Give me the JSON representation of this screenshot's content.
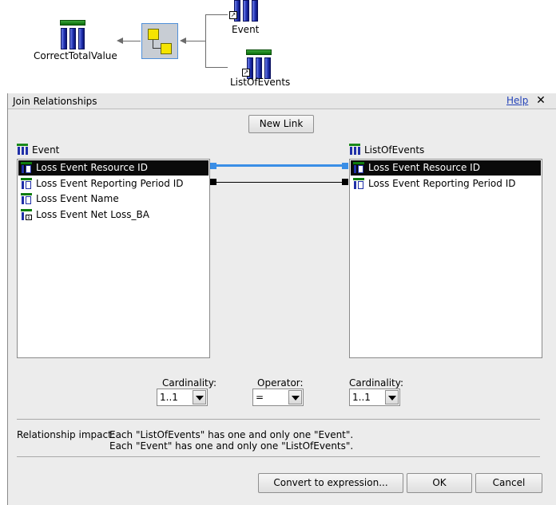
{
  "diagram": {
    "nodes": {
      "correct_total": "CorrectTotalValue",
      "event": "Event",
      "list_of_events": "ListOfEvents"
    }
  },
  "dialog": {
    "title": "Join Relationships",
    "help": "Help",
    "close": "✕",
    "new_link": "New Link",
    "left": {
      "header": "Event",
      "rows": [
        {
          "label": "Loss Event Resource ID",
          "selected": true,
          "icon": "column-icon"
        },
        {
          "label": "Loss Event Reporting Period ID",
          "selected": false,
          "icon": "column-icon"
        },
        {
          "label": "Loss Event Name",
          "selected": false,
          "icon": "column-icon"
        },
        {
          "label": "Loss Event Net Loss_BA",
          "selected": false,
          "icon": "calculated-column-icon"
        }
      ]
    },
    "right": {
      "header": "ListOfEvents",
      "rows": [
        {
          "label": "Loss Event Resource ID",
          "selected": true,
          "icon": "column-icon"
        },
        {
          "label": "Loss Event Reporting Period ID",
          "selected": false,
          "icon": "column-icon"
        }
      ]
    },
    "link_colors": {
      "selected": "#3a8ee6",
      "normal": "#000000"
    },
    "cardinality_left": {
      "label": "Cardinality:",
      "value": "1..1"
    },
    "operator": {
      "label": "Operator:",
      "value": "="
    },
    "cardinality_right": {
      "label": "Cardinality:",
      "value": "1..1"
    },
    "impact": {
      "label": "Relationship impact:",
      "line1": "Each \"ListOfEvents\" has one and only one \"Event\".",
      "line2": "Each \"Event\" has one and only one \"ListOfEvents\"."
    },
    "buttons": {
      "convert": "Convert to expression...",
      "ok": "OK",
      "cancel": "Cancel"
    }
  }
}
